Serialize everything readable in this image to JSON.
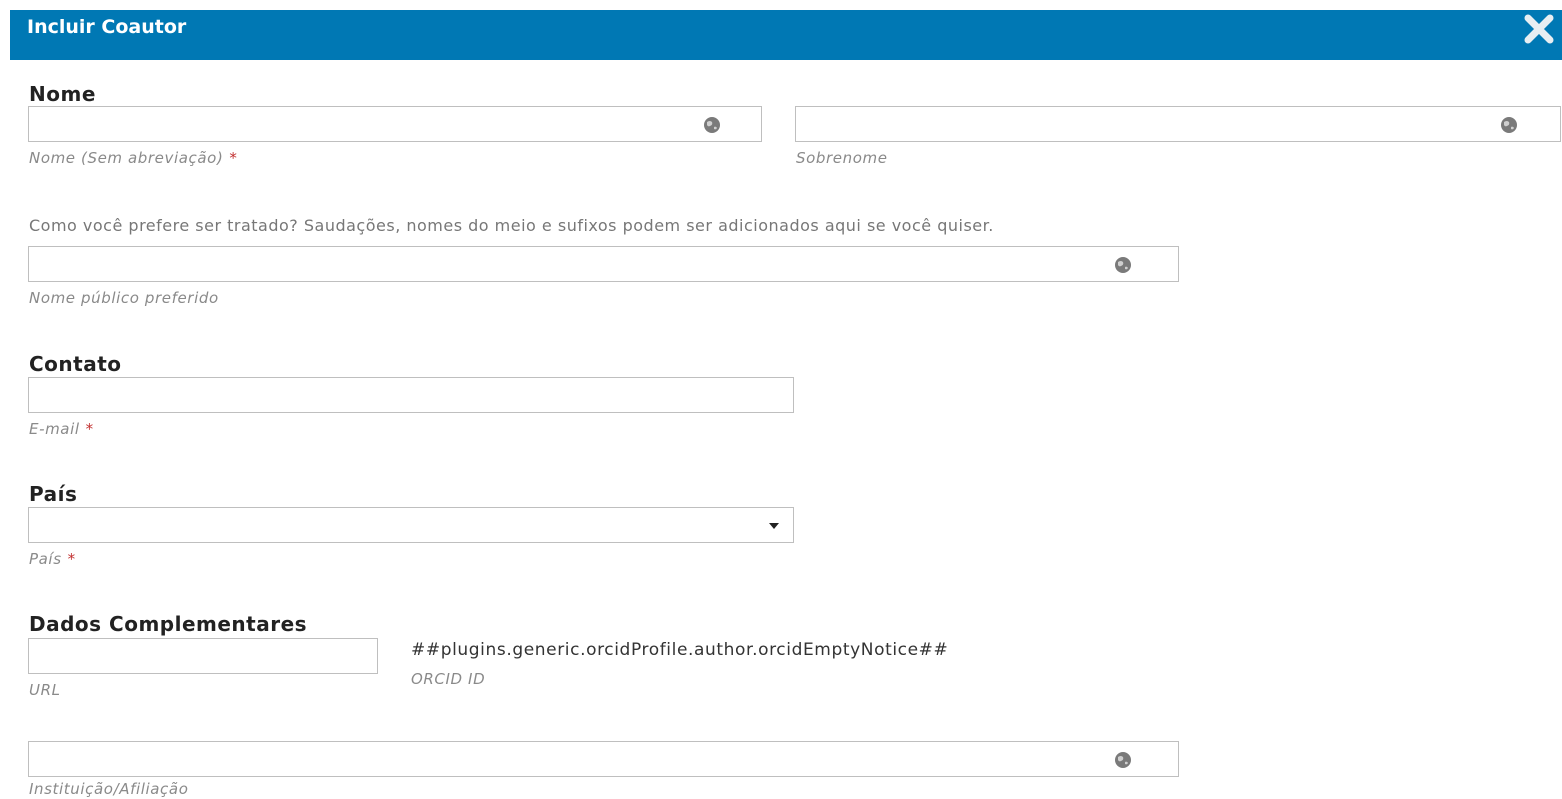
{
  "dialog": {
    "title": "Incluir Coautor",
    "close_icon": "close-icon"
  },
  "nome": {
    "section_title": "Nome",
    "first_name_label": "Nome (Sem abreviação)",
    "last_name_label": "Sobrenome",
    "preferred_description": "Como você prefere ser tratado? Saudações, nomes do meio e sufixos podem ser adicionados aqui se você quiser.",
    "preferred_label": "Nome público preferido",
    "required_mark": "*"
  },
  "contato": {
    "section_title": "Contato",
    "email_label": "E-mail",
    "required_mark": "*"
  },
  "pais": {
    "section_title": "País",
    "select_label": "País",
    "selected_value": "",
    "required_mark": "*"
  },
  "dados": {
    "section_title": "Dados Complementares",
    "url_label": "URL",
    "orcid_notice": "##plugins.generic.orcidProfile.author.orcidEmptyNotice##",
    "orcid_label": "ORCID ID",
    "affiliation_label": "Instituição/Afiliação"
  },
  "colors": {
    "header": "#0078b4",
    "required": "#c23030"
  },
  "icons": {
    "multilingual": "globe-icon"
  }
}
